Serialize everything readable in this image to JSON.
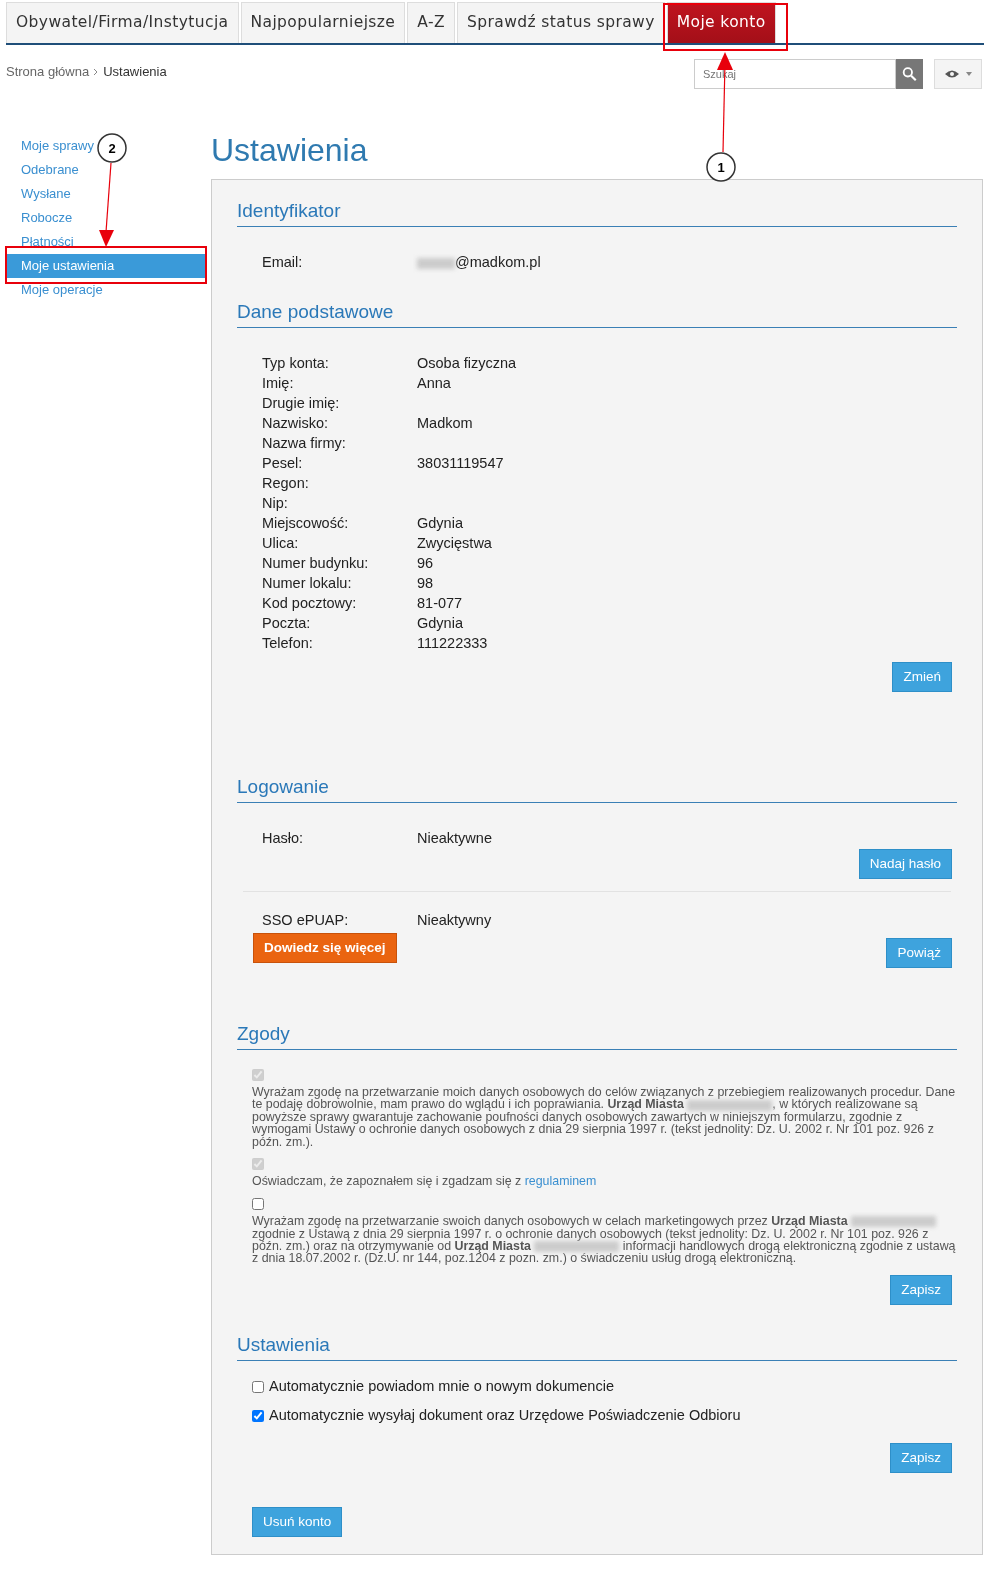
{
  "nav_tabs": [
    {
      "label": "Obywatel/Firma/Instytucja",
      "selected": false
    },
    {
      "label": "Najpopularniejsze",
      "selected": false
    },
    {
      "label": "A-Z",
      "selected": false
    },
    {
      "label": "Sprawdź status sprawy",
      "selected": false
    },
    {
      "label": "Moje konto",
      "selected": true
    }
  ],
  "breadcrumb": [
    "Strona główna",
    "Ustawienia"
  ],
  "search": {
    "placeholder": "Szukaj"
  },
  "sidebar": {
    "items": [
      {
        "label": "Moje sprawy",
        "selected": false
      },
      {
        "label": "Odebrane",
        "selected": false
      },
      {
        "label": "Wysłane",
        "selected": false
      },
      {
        "label": "Robocze",
        "selected": false
      },
      {
        "label": "Płatności",
        "selected": false
      },
      {
        "label": "Moje ustawienia",
        "selected": true
      },
      {
        "label": "Moje operacje",
        "selected": false
      }
    ]
  },
  "page_title": "Ustawienia",
  "identyfikator": {
    "title": "Identyfikator",
    "email_label": "Email:",
    "email_visible": "@madkom.pl"
  },
  "dane": {
    "title": "Dane podstawowe",
    "fields": [
      {
        "label": "Typ konta:",
        "value": "Osoba fizyczna"
      },
      {
        "label": "Imię:",
        "value": "Anna"
      },
      {
        "label": "Drugie imię:"
      },
      {
        "label": "Nazwisko:",
        "value": "Madkom"
      },
      {
        "label": "Nazwa firmy:"
      },
      {
        "label": "Pesel:",
        "value": "38031119547"
      },
      {
        "label": "Regon:"
      },
      {
        "label": "Nip:"
      },
      {
        "label": "Miejscowość:",
        "value": "Gdynia"
      },
      {
        "label": "Ulica:",
        "value": "Zwycięstwa"
      },
      {
        "label": "Numer budynku:",
        "value": "96"
      },
      {
        "label": "Numer lokalu:",
        "value": "98"
      },
      {
        "label": "Kod pocztowy:",
        "value": "81-077"
      },
      {
        "label": "Poczta:",
        "value": "Gdynia"
      },
      {
        "label": "Telefon:",
        "value": "111222333"
      }
    ],
    "button": "Zmień"
  },
  "logowanie": {
    "title": "Logowanie",
    "password_label": "Hasło:",
    "password_value": "Nieaktywne",
    "password_button": "Nadaj hasło",
    "sso_label": "SSO ePUAP:",
    "sso_value": "Nieaktywny",
    "learn_more_button": "Dowiedz się więcej",
    "link_button": "Powiąż"
  },
  "zgody": {
    "title": "Zgody",
    "consents": [
      {
        "checked": true,
        "disabled": true,
        "segments": [
          {
            "kind": "text",
            "text": "Wyrażam zgodę na przetwarzanie moich danych osobowych do celów związanych z przebiegiem realizowanych procedur. Dane te podaję dobrowolnie, mam prawo do wglądu i ich poprawiania. **Urząd Miasta** "
          },
          {
            "kind": "redacted"
          },
          {
            "kind": "text",
            "text": ", w których realizowane są powyższe sprawy gwarantuje zachowanie poufności danych osobowych zawartych w niniejszym formularzu, zgodnie z wymogami Ustawy o ochronie danych osobowych z dnia 29 sierpnia 1997 r. (tekst jednolity: Dz. U. 2002 r. Nr 101 poz. 926 z późn. zm.)."
          }
        ]
      },
      {
        "checked": true,
        "disabled": true,
        "segments": [
          {
            "kind": "text",
            "text": "Oświadczam, że zapoznałem się i zgadzam się z "
          },
          {
            "kind": "link",
            "text": "regulaminem"
          }
        ]
      },
      {
        "checked": false,
        "disabled": false,
        "segments": [
          {
            "kind": "text",
            "text": "Wyrażam zgodę na przetwarzanie swoich danych osobowych w celach marketingowych przez **Urząd Miasta** "
          },
          {
            "kind": "redacted"
          },
          {
            "kind": "text",
            "text": " zgodnie z Ustawą z dnia 29 sierpnia 1997 r. o ochronie danych osobowych (tekst jednolity: Dz. U. 2002 r. Nr 101 poz. 926 z późn. zm.) oraz na otrzymywanie od **Urząd Miasta** "
          },
          {
            "kind": "redacted"
          },
          {
            "kind": "text",
            "text": " informacji handlowych drogą elektroniczną zgodnie z ustawą z dnia 18.07.2002 r. (Dz.U. nr 144, poz.1204 z pozn. zm.) o świadczeniu usług drogą elektroniczną."
          }
        ]
      }
    ],
    "button": "Zapisz"
  },
  "ustawienia": {
    "title": "Ustawienia",
    "options": [
      {
        "label": "Automatycznie powiadom mnie o nowym dokumencie",
        "checked": false
      },
      {
        "label": "Automatycznie wysyłaj dokument oraz Urzędowe Poświadczenie Odbioru",
        "checked": true
      }
    ],
    "button": "Zapisz"
  },
  "delete_button": "Usuń konto",
  "annotations": [
    {
      "number": "1"
    },
    {
      "number": "2"
    }
  ]
}
